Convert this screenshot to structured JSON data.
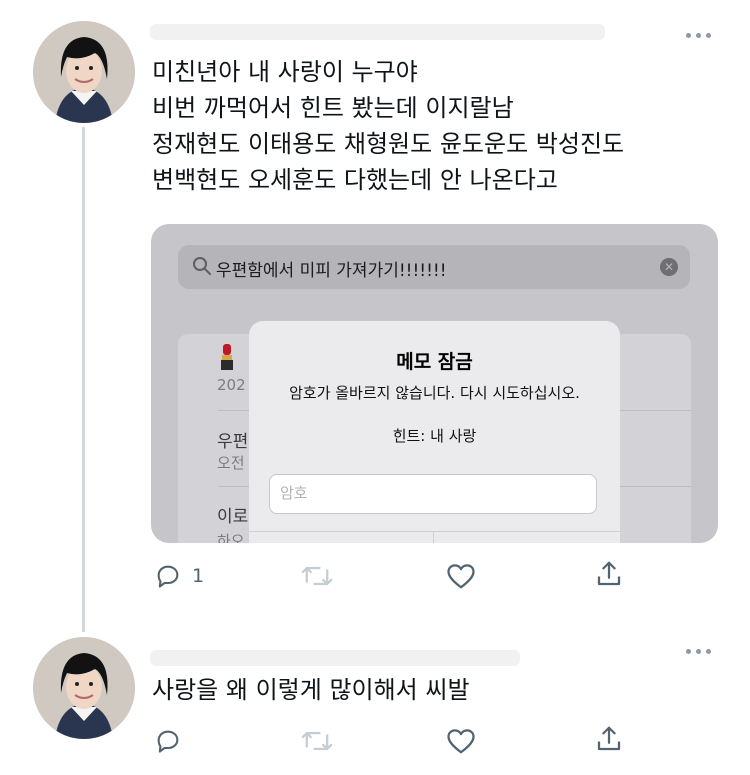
{
  "tweets": [
    {
      "text_lines": [
        "미친년아 내 사랑이 누구야",
        "비번 까먹어서 힌트 봤는데 이지랄남",
        "정재현도 이태용도 채형원도 윤도운도 박성진도",
        "변백현도 오세훈도 다했는데 안 나온다고"
      ],
      "reply_count": "1",
      "actions": [
        "reply-icon",
        "retweet-icon",
        "like-icon",
        "share-icon"
      ]
    },
    {
      "text_lines": [
        "사랑을 왜 이렇게 많이해서 씨발"
      ],
      "actions": [
        "reply-icon",
        "retweet-icon",
        "like-icon",
        "share-icon"
      ]
    }
  ],
  "screenshot": {
    "search_text": "우편함에서 미피 가져가기!!!!!!!",
    "list_items": [
      {
        "emoji": "💄",
        "title": "",
        "subtitle": "202"
      },
      {
        "title": "우편",
        "subtitle": "오전"
      },
      {
        "title": "이로",
        "subtitle": "하오"
      }
    ],
    "alert": {
      "title": "메모 잠금",
      "message": "암호가 올바르지 않습니다. 다시 시도하십시오.",
      "hint": "힌트: 내 사랑",
      "password_placeholder": "암호"
    }
  },
  "colors": {
    "icon": "#536471",
    "thread_line": "#cfd9de",
    "alert_bg": "#ebebed",
    "screenshot_bg": "#c6c6ca"
  }
}
